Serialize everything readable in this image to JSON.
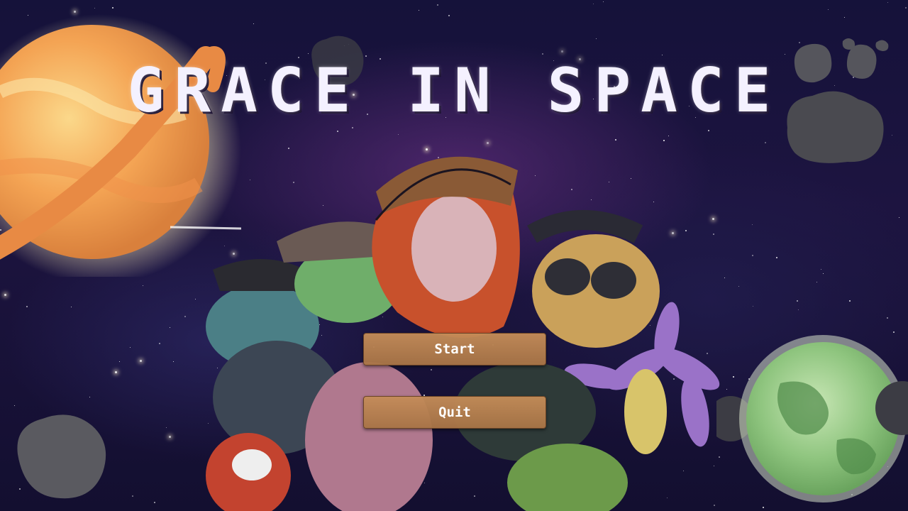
{
  "menu": {
    "title": "GRACE IN SPACE",
    "start_label": "Start",
    "quit_label": "Quit"
  },
  "colors": {
    "button_fill": "#b57f4d",
    "button_border": "#6b4426",
    "title_text": "#f4f1ff",
    "background": "#15123a"
  },
  "icons": {
    "orange_planet": "ringed-planet-illustration",
    "green_planet": "green-planet-illustration",
    "asteroids": "asteroid-illustration",
    "characters": "cast-illustration"
  }
}
